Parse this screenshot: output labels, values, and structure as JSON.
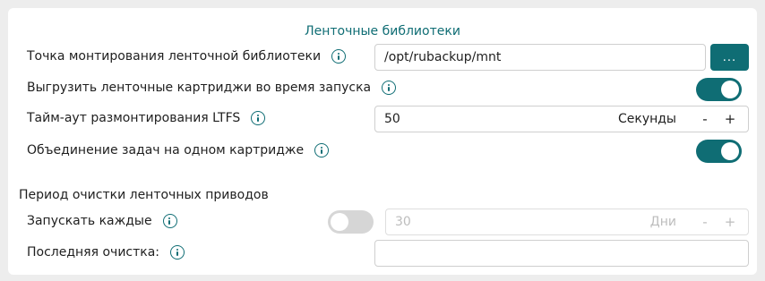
{
  "section": {
    "title": "Ленточные библиотеки"
  },
  "rows": {
    "mount_point": {
      "label": "Точка монтирования ленточной библиотеки",
      "value": "/opt/rubackup/mnt",
      "browse_label": "..."
    },
    "unload": {
      "label": "Выгрузить ленточные картриджи во время запуска",
      "toggle": true
    },
    "ltfs_timeout": {
      "label": "Тайм-аут размонтирования LTFS",
      "value": "50",
      "unit": "Секунды",
      "minus": "-",
      "plus": "+"
    },
    "merge_tasks": {
      "label": "Объединение задач на одном картридже",
      "toggle": true
    }
  },
  "cleanup": {
    "title": "Период очистки ленточных приводов",
    "run_every": {
      "label": "Запускать каждые",
      "toggle": false,
      "value": "30",
      "unit": "Дни",
      "minus": "-",
      "plus": "+"
    },
    "last_cleanup": {
      "label": "Последняя очистка:",
      "value": ""
    }
  },
  "colors": {
    "accent": "#0f6d74",
    "toggle_off": "#d6d6d6",
    "background": "#ededed"
  },
  "icons": {
    "info": "info-circle-icon"
  }
}
